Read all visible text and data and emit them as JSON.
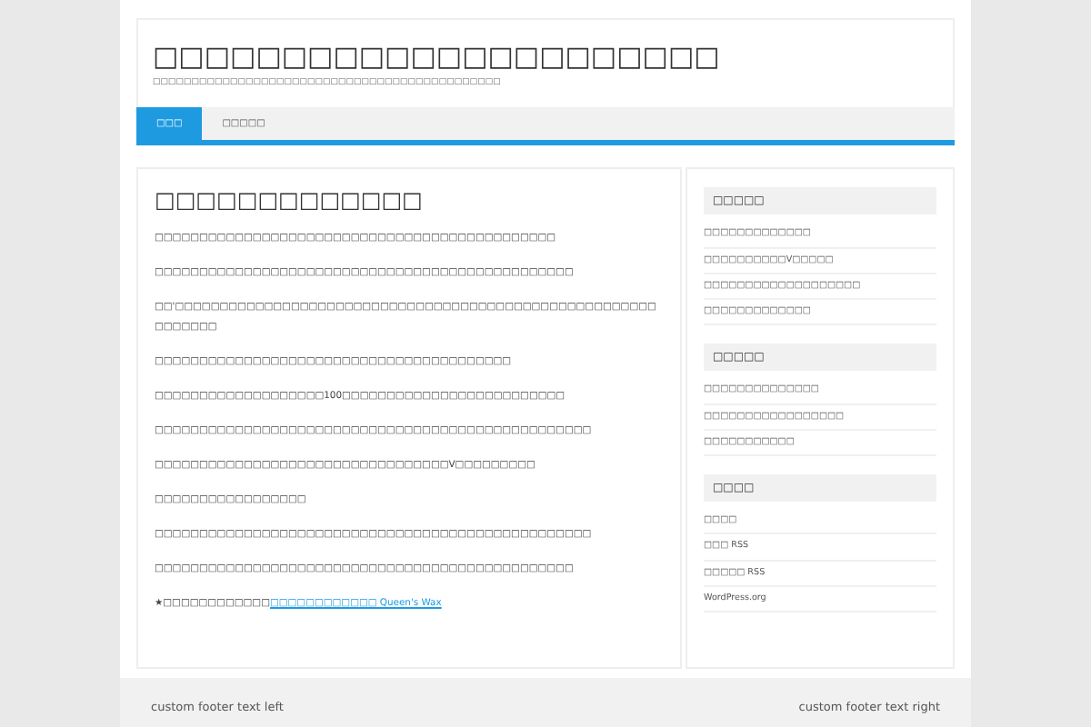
{
  "site": {
    "title": "□□□□□□□□□□□□□□□□□□□□□□",
    "tagline": "□□□□□□□□□□□□□□□□□□□□□□□□□□□□□□□□□□□□□□□□□□□□□"
  },
  "nav": [
    {
      "label": "□□□",
      "selected": true
    },
    {
      "label": "□□□□□",
      "selected": false
    }
  ],
  "post": {
    "title": "□□□□□□□□□□□□□",
    "paragraphs": [
      {
        "text": "□□□□□□□□□□□□□□□□□□□□□□□□□□□□□□□□□□□□□□□□□□□□□"
      },
      {
        "text": "□□□□□□□□□□□□□□□□□□□□□□□□□□□□□□□□□□□□□□□□□□□□□□□"
      },
      {
        "text": "□□'□□□□□□□□□□□□□□□□□□□□□□□□□□□□□□□□□□□□□□□□□□□□□□□□□□□□□□□□□□□□□"
      },
      {
        "text": "□□□□□□□□□□□□□□□□□□□□□□□□□□□□□□□□□□□□□□□□"
      },
      {
        "text": "□□□□□□□□□□□□□□□□□□□100□□□□□□□□□□□□□□□□□□□□□□□□□"
      },
      {
        "text": "□□□□□□□□□□□□□□□□□□□□□□□□□□□□□□□□□□□□□□□□□□□□□□□□□"
      },
      {
        "text": "□□□□□□□□□□□□□□□□□□□□□□□□□□□□□□□□□V□□□□□□□□□"
      },
      {
        "text": "□□□□□□□□□□□□□□□□□"
      },
      {
        "text": "□□□□□□□□□□□□□□□□□□□□□□□□□□□□□□□□□□□□□□□□□□□□□□□□□"
      },
      {
        "text": "□□□□□□□□□□□□□□□□□□□□□□□□□□□□□□□□□□□□□□□□□□□□□□□"
      },
      {
        "text": "★□□□□□□□□□□□□",
        "link": "□□□□□□□□□□□□ Queen's Wax"
      }
    ]
  },
  "sidebar": [
    {
      "title": "□□□□□",
      "items": [
        "□□□□□□□□□□□□□",
        "□□□□□□□□□□V□□□□□",
        "□□□□□□□□□□□□□□□□□□□",
        "□□□□□□□□□□□□□"
      ]
    },
    {
      "title": "□□□□□",
      "items": [
        "□□□□□□□□□□□□□□",
        "□□□□□□□□□□□□□□□□□",
        "□□□□□□□□□□□"
      ]
    },
    {
      "title": "□□□□",
      "items": [
        "□□□□",
        "□□□ RSS",
        "□□□□□ RSS",
        "WordPress.org"
      ]
    }
  ],
  "footer": {
    "left": "custom footer text left",
    "right": "custom footer text right"
  }
}
